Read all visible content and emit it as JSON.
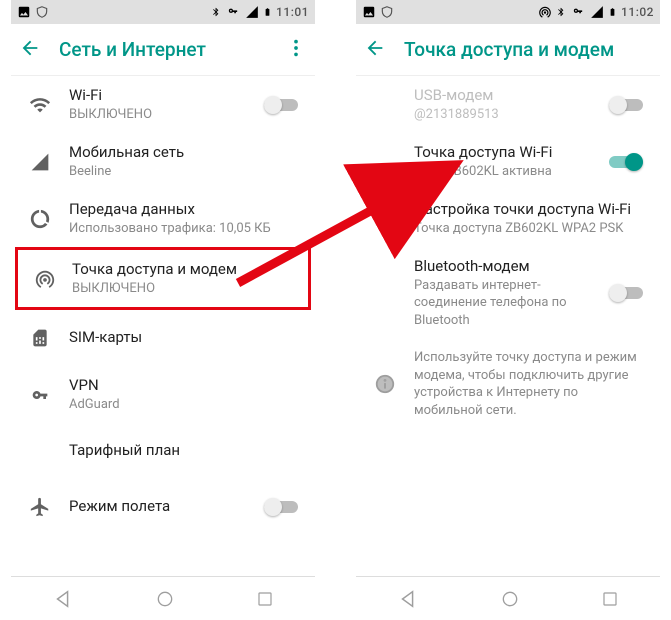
{
  "left": {
    "status": {
      "time": "11:01"
    },
    "appbar": {
      "title": "Сеть и Интернет"
    },
    "items": [
      {
        "title": "Wi-Fi",
        "sub": "ВЫКЛЮЧЕНО",
        "switch": "off"
      },
      {
        "title": "Мобильная сеть",
        "sub": "Beeline"
      },
      {
        "title": "Передача данных",
        "sub": "Использовано трафика: 10,05 КБ"
      },
      {
        "title": "Точка доступа и модем",
        "sub": "ВЫКЛЮЧЕНО"
      },
      {
        "title": "SIM-карты"
      },
      {
        "title": "VPN",
        "sub": "AdGuard"
      },
      {
        "title": "Тарифный план"
      },
      {
        "title": "Режим полета",
        "switch": "off"
      }
    ]
  },
  "right": {
    "status": {
      "time": "11:02"
    },
    "appbar": {
      "title": "Точка доступа и модем"
    },
    "items": [
      {
        "title": "USB-модем",
        "sub": "@2131889513",
        "disabled": true,
        "switch": "off"
      },
      {
        "title": "Точка доступа Wi-Fi",
        "sub": "Сеть ZB602KL активна",
        "switch": "on"
      },
      {
        "title": "Настройка точки доступа Wi-Fi",
        "sub": "Точка доступа ZB602KL WPA2 PSK"
      },
      {
        "title": "Bluetooth-модем",
        "sub": "Раздавать интернет-соединение телефона по Bluetooth",
        "switch": "off"
      }
    ],
    "info": "Используйте точку доступа и режим модема, чтобы подключить другие устройства к Интернету по мобильной сети."
  }
}
